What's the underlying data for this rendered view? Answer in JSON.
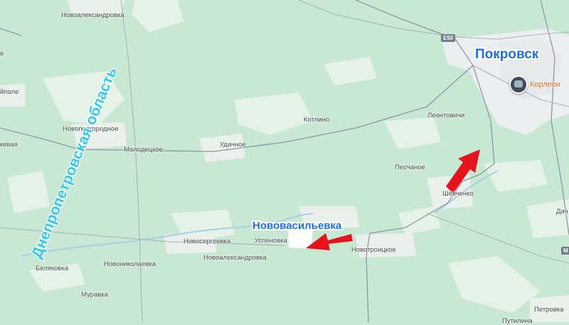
{
  "map": {
    "colors": {
      "land": "#c9e8d3",
      "fields": "#e8f4ea",
      "towns": "#eef2ef",
      "boundary": "#8c97a3",
      "road": "#9aa7b3",
      "river": "#b8d8ec",
      "arrow": "#e5141c",
      "highlight_label": "#1d6fe0",
      "region_label": "#34c6ec"
    },
    "highlight_labels": {
      "pokrovsk": "Покровск",
      "novovasilevka": "Нововасильевка"
    },
    "region_label": "Днепропетровская область",
    "route_shield": "E50",
    "route_shield_m": "M",
    "poi": {
      "label": "Корлеон",
      "icon": "photo-avatar-icon"
    },
    "places": {
      "novoaleksandrovka_n": "Новоалександровка",
      "pole": "йполе",
      "novopodgorodnoe": "Новоподгородное",
      "kevaya": "кевая",
      "molodetskoe": "Молодецкое",
      "udachnoe": "Удачное",
      "kotlino": "Котлино",
      "leontovichi": "Леонтовичи",
      "peschanoe": "Песчаное",
      "shevchenko": "Шевченко",
      "dach": "Дач",
      "novosergeevka": "Новосергеевка",
      "uspenovka": "Успеновка",
      "novoaleksandrovka_s": "Новоалександровка",
      "novotroitskoe": "Новотроицкое",
      "belyakovka": "Беляковка",
      "novonikolaevka": "Новониколаевка",
      "muravka": "Муравка",
      "petrovka": "Петровка",
      "putilina": "Путилина",
      "e_left": "е"
    },
    "arrows": [
      {
        "name": "arrow-toward-pokrovsk",
        "direction": "north-east"
      },
      {
        "name": "arrow-toward-novovasilevka",
        "direction": "west"
      }
    ]
  }
}
